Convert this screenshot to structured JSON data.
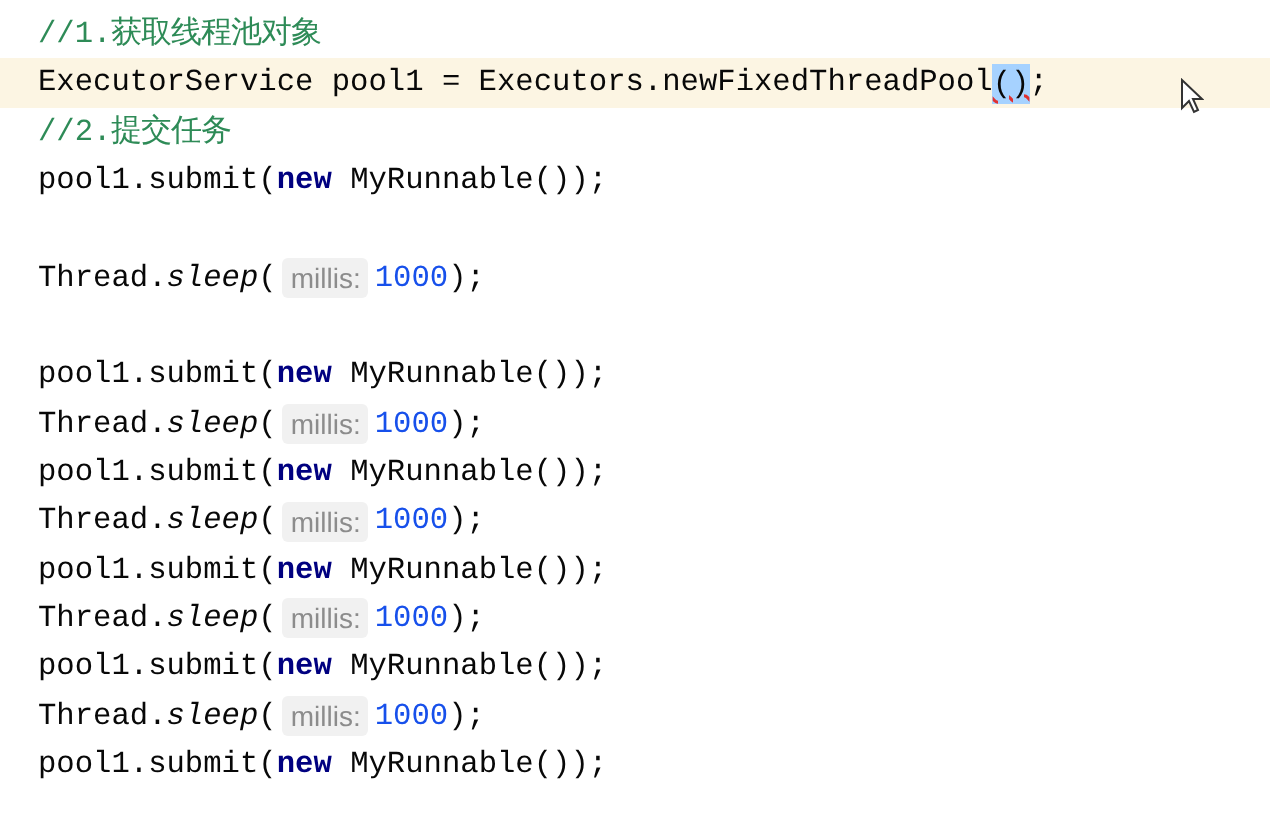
{
  "editor": {
    "lines": [
      {
        "kind": "code",
        "current": false,
        "tokens": [
          {
            "kind": "comment",
            "text": "//1.获取线程池对象"
          }
        ]
      },
      {
        "kind": "code",
        "current": true,
        "tokens": [
          {
            "kind": "plain",
            "text": "ExecutorService pool1 = Executors.newFixedThreadPool"
          },
          {
            "kind": "brace",
            "text": "()"
          },
          {
            "kind": "plain",
            "text": ";"
          }
        ]
      },
      {
        "kind": "code",
        "current": false,
        "tokens": [
          {
            "kind": "comment",
            "text": "//2.提交任务"
          }
        ]
      },
      {
        "kind": "code",
        "current": false,
        "tokens": [
          {
            "kind": "plain",
            "text": "pool1.submit("
          },
          {
            "kind": "keyword",
            "text": "new"
          },
          {
            "kind": "plain",
            "text": " MyRunnable());"
          }
        ]
      },
      {
        "kind": "blank",
        "current": false
      },
      {
        "kind": "code",
        "current": false,
        "tokens": [
          {
            "kind": "plain",
            "text": "Thread."
          },
          {
            "kind": "static",
            "text": "sleep"
          },
          {
            "kind": "plain",
            "text": "("
          },
          {
            "kind": "hint",
            "text": "millis:"
          },
          {
            "kind": "number",
            "text": "1000"
          },
          {
            "kind": "plain",
            "text": ");"
          }
        ]
      },
      {
        "kind": "blank",
        "current": false
      },
      {
        "kind": "code",
        "current": false,
        "tokens": [
          {
            "kind": "plain",
            "text": "pool1.submit("
          },
          {
            "kind": "keyword",
            "text": "new"
          },
          {
            "kind": "plain",
            "text": " MyRunnable());"
          }
        ]
      },
      {
        "kind": "code",
        "current": false,
        "tokens": [
          {
            "kind": "plain",
            "text": "Thread."
          },
          {
            "kind": "static",
            "text": "sleep"
          },
          {
            "kind": "plain",
            "text": "("
          },
          {
            "kind": "hint",
            "text": "millis:"
          },
          {
            "kind": "number",
            "text": "1000"
          },
          {
            "kind": "plain",
            "text": ");"
          }
        ]
      },
      {
        "kind": "code",
        "current": false,
        "tokens": [
          {
            "kind": "plain",
            "text": "pool1.submit("
          },
          {
            "kind": "keyword",
            "text": "new"
          },
          {
            "kind": "plain",
            "text": " MyRunnable());"
          }
        ]
      },
      {
        "kind": "code",
        "current": false,
        "tokens": [
          {
            "kind": "plain",
            "text": "Thread."
          },
          {
            "kind": "static",
            "text": "sleep"
          },
          {
            "kind": "plain",
            "text": "("
          },
          {
            "kind": "hint",
            "text": "millis:"
          },
          {
            "kind": "number",
            "text": "1000"
          },
          {
            "kind": "plain",
            "text": ");"
          }
        ]
      },
      {
        "kind": "code",
        "current": false,
        "tokens": [
          {
            "kind": "plain",
            "text": "pool1.submit("
          },
          {
            "kind": "keyword",
            "text": "new"
          },
          {
            "kind": "plain",
            "text": " MyRunnable());"
          }
        ]
      },
      {
        "kind": "code",
        "current": false,
        "tokens": [
          {
            "kind": "plain",
            "text": "Thread."
          },
          {
            "kind": "static",
            "text": "sleep"
          },
          {
            "kind": "plain",
            "text": "("
          },
          {
            "kind": "hint",
            "text": "millis:"
          },
          {
            "kind": "number",
            "text": "1000"
          },
          {
            "kind": "plain",
            "text": ");"
          }
        ]
      },
      {
        "kind": "code",
        "current": false,
        "tokens": [
          {
            "kind": "plain",
            "text": "pool1.submit("
          },
          {
            "kind": "keyword",
            "text": "new"
          },
          {
            "kind": "plain",
            "text": " MyRunnable());"
          }
        ]
      },
      {
        "kind": "code",
        "current": false,
        "tokens": [
          {
            "kind": "plain",
            "text": "Thread."
          },
          {
            "kind": "static",
            "text": "sleep"
          },
          {
            "kind": "plain",
            "text": "("
          },
          {
            "kind": "hint",
            "text": "millis:"
          },
          {
            "kind": "number",
            "text": "1000"
          },
          {
            "kind": "plain",
            "text": ");"
          }
        ]
      },
      {
        "kind": "code",
        "current": false,
        "tokens": [
          {
            "kind": "plain",
            "text": "pool1.submit("
          },
          {
            "kind": "keyword",
            "text": "new"
          },
          {
            "kind": "plain",
            "text": " MyRunnable());"
          }
        ]
      }
    ]
  }
}
